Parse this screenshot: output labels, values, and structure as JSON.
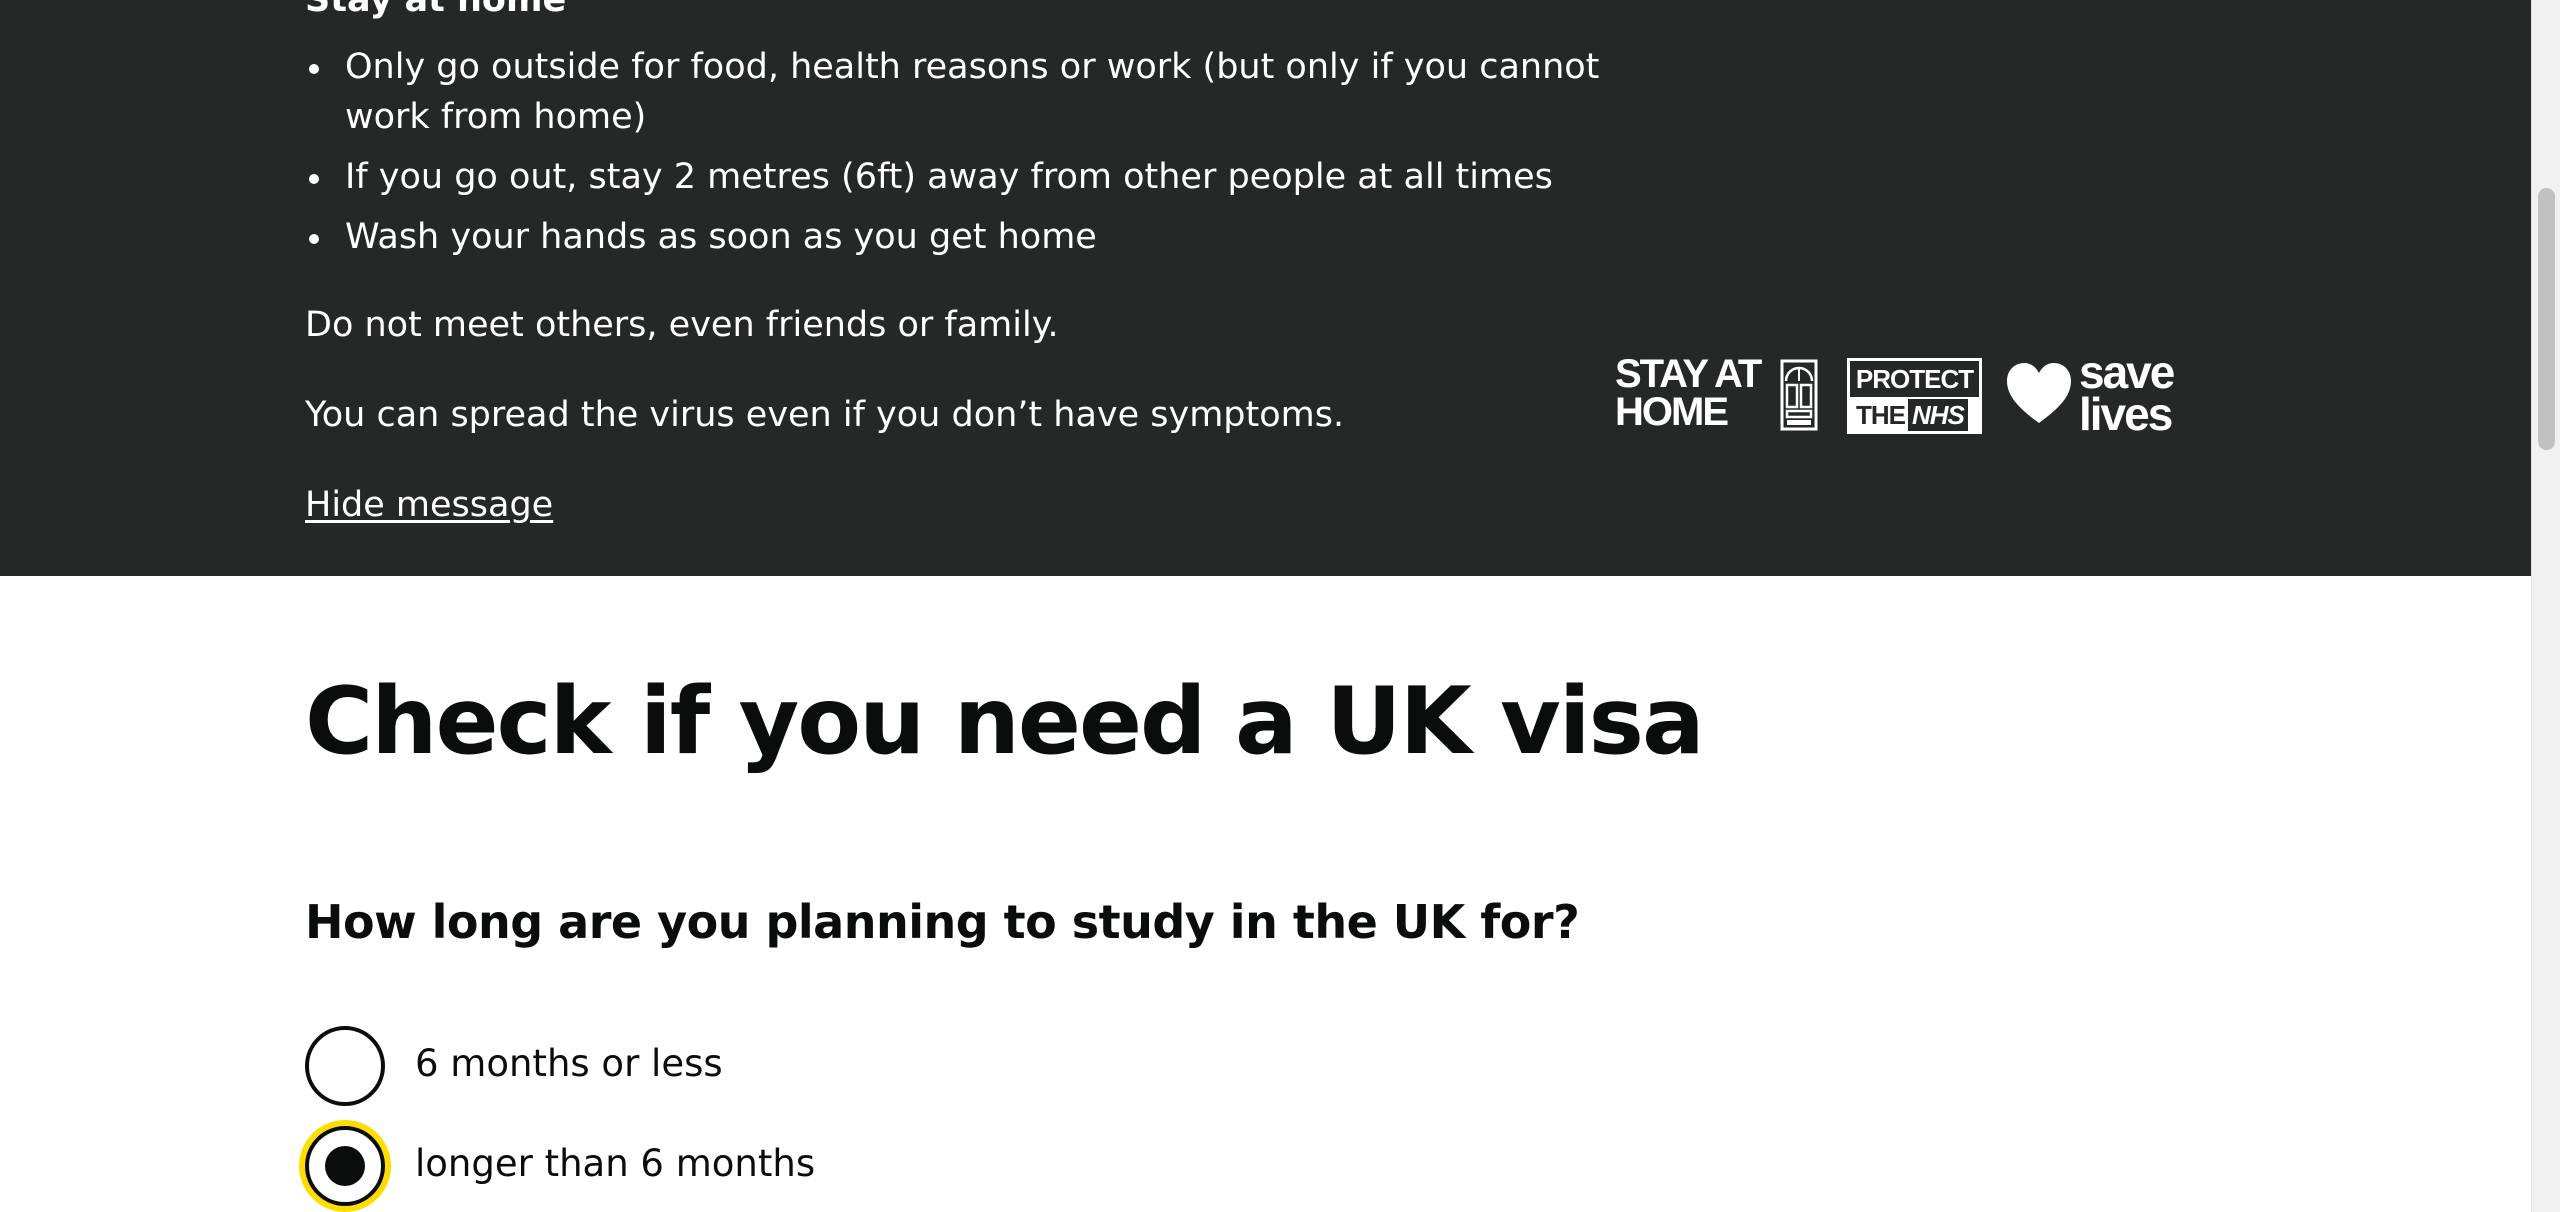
{
  "banner": {
    "heading": "Stay at home",
    "bullets": [
      "Only go outside for food, health reasons or work (but only if you cannot work from home)",
      "If you go out, stay 2 metres (6ft) away from other people at all times",
      "Wash your hands as soon as you get home"
    ],
    "paragraph_1": "Do not meet others, even friends or family.",
    "paragraph_2": "You can spread the virus even if you don’t have symptoms.",
    "hide_link": "Hide message",
    "logos": {
      "stay_at_home": "STAY AT\nHOME",
      "protect_line_1": "PROTECT",
      "protect_the": "THE",
      "protect_nhs": "NHS",
      "save_lives": "save\nlives"
    },
    "colors": {
      "background": "#262828",
      "text": "#ffffff"
    }
  },
  "main": {
    "title": "Check if you need a UK visa",
    "question": "How long are you planning to study in the UK for?",
    "options": [
      {
        "label": "6 months or less",
        "selected": false
      },
      {
        "label": "longer than 6 months",
        "selected": true
      }
    ],
    "colors": {
      "text": "#0b0c0c",
      "focus": "#ffdd00"
    }
  }
}
